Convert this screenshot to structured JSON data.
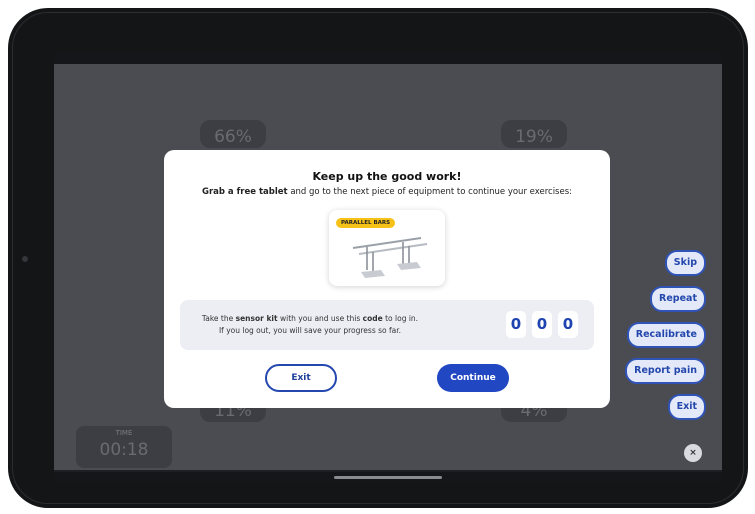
{
  "stats": {
    "top_left": "66%",
    "top_right": "19%",
    "bottom_left": "11%",
    "bottom_right": "4%"
  },
  "timer": {
    "label": "TIME",
    "value": "00:18"
  },
  "side_buttons": {
    "skip": "Skip",
    "repeat": "Repeat",
    "recalibrate": "Recalibrate",
    "report_pain": "Report pain",
    "exit": "Exit",
    "close": "×"
  },
  "modal": {
    "title": "Keep up the good work!",
    "subtitle_bold": "Grab a free tablet",
    "subtitle_rest": " and go to the next piece of equipment to continue your exercises:",
    "equipment_tag": "PARALLEL BARS",
    "code_text_1a": "Take the ",
    "code_text_1b": "sensor kit",
    "code_text_1c": " with you and use this ",
    "code_text_1d": "code",
    "code_text_1e": " to log in.",
    "code_text_2": "If you log out, you will save your progress so far.",
    "code_digits": [
      "0",
      "0",
      "0"
    ],
    "exit_label": "Exit",
    "continue_label": "Continue"
  },
  "colors": {
    "primary_blue": "#2148c2",
    "tag_yellow": "#f6c218"
  }
}
